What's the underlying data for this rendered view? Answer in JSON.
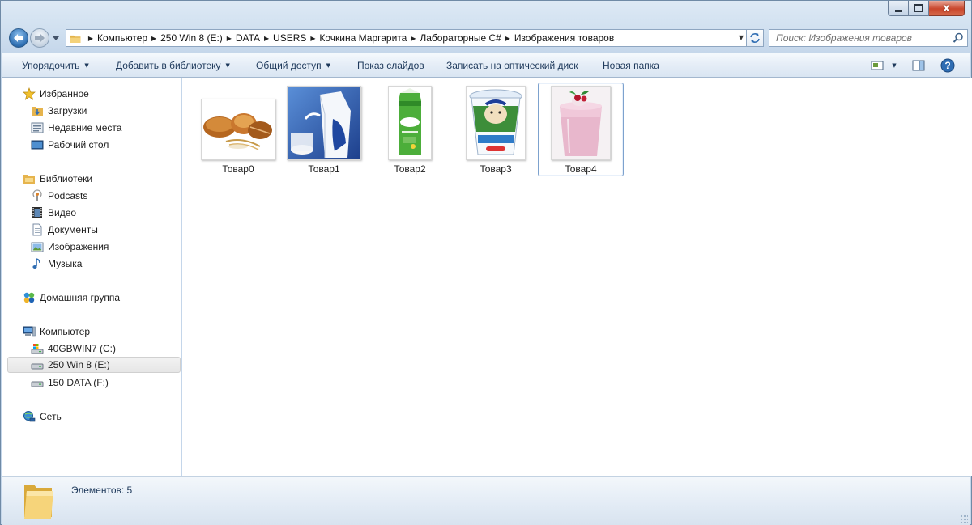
{
  "window": {
    "caption_close": "x"
  },
  "address": {
    "breadcrumbs": [
      "Компьютер",
      "250 Win 8 (E:)",
      "DATA",
      "USERS",
      "Кочкина Маргарита",
      "Лабораторные C#",
      "Изображения товаров"
    ]
  },
  "search": {
    "placeholder": "Поиск: Изображения товаров"
  },
  "toolbar": {
    "organize": "Упорядочить",
    "add_to_library": "Добавить в библиотеку",
    "share": "Общий доступ",
    "slideshow": "Показ слайдов",
    "burn": "Записать на оптический диск",
    "new_folder": "Новая папка",
    "help": "?"
  },
  "nav": {
    "favorites": {
      "label": "Избранное",
      "items": [
        "Загрузки",
        "Недавние места",
        "Рабочий стол"
      ]
    },
    "libraries": {
      "label": "Библиотеки",
      "items": [
        "Podcasts",
        "Видео",
        "Документы",
        "Изображения",
        "Музыка"
      ]
    },
    "homegroup": {
      "label": "Домашняя группа"
    },
    "computer": {
      "label": "Компьютер",
      "items": [
        "40GBWIN7 (C:)",
        "250 Win 8 (E:)",
        "150 DATA (F:)"
      ],
      "selected": "250 Win 8 (E:)"
    },
    "network": {
      "label": "Сеть"
    }
  },
  "files": [
    {
      "name": "Товар0",
      "icon": "bread-thumbnail"
    },
    {
      "name": "Товар1",
      "icon": "milk-carton-thumbnail"
    },
    {
      "name": "Товар2",
      "icon": "kefir-carton-thumbnail"
    },
    {
      "name": "Товар3",
      "icon": "sour-cream-cup-thumbnail"
    },
    {
      "name": "Товар4",
      "icon": "smoothie-glass-thumbnail"
    }
  ],
  "selected_file": "Товар4",
  "status": {
    "count_text": "Элементов: 5"
  },
  "colors": {
    "toolbar_text": "#1e395b",
    "selection_border": "#7da2ce",
    "close_button": "#c9462c"
  }
}
